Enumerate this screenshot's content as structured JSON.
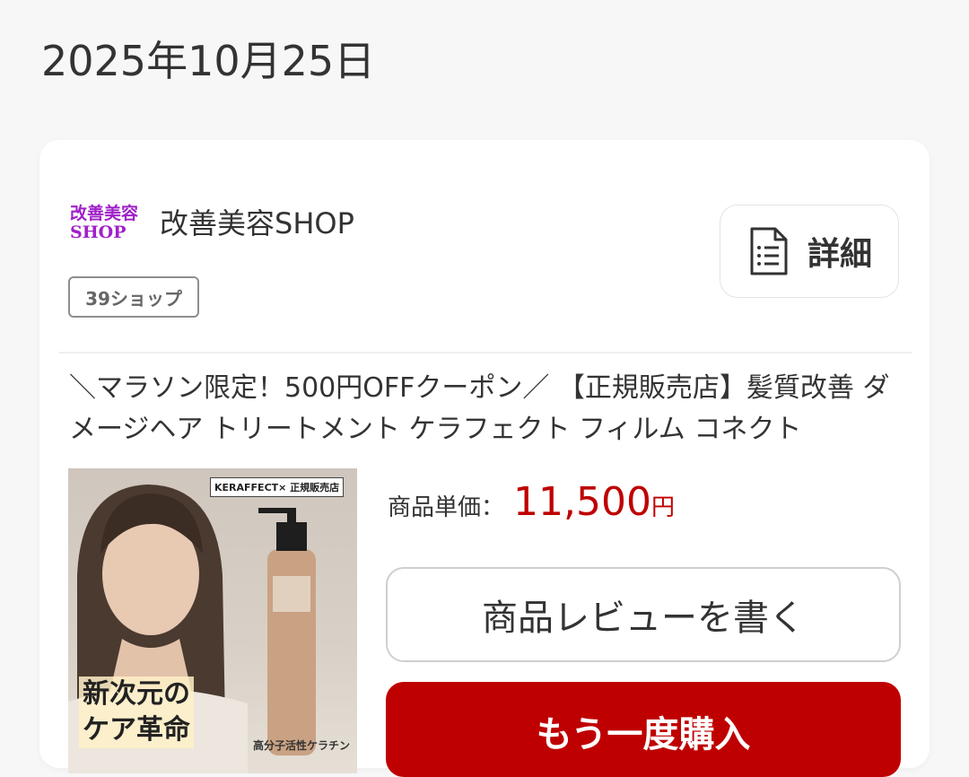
{
  "order": {
    "date": "2025年10月25日"
  },
  "shop": {
    "logo_line1": "改善美容",
    "logo_line2": "SHOP",
    "name": "改善美容SHOP",
    "badge": "39ショップ",
    "detail_label": "詳細"
  },
  "item": {
    "title": "＼マラソン限定！500円OFFクーポン／ 【正規販売店】髪質改善 ダメージヘア トリートメント ケラフェクト フィルム コネクト",
    "image": {
      "brand_tag": "KERAFFECT× 正規販売店",
      "catch_line1": "新次元の",
      "catch_line2": "ケア革命",
      "keratin_text": "高分子活性ケラチン"
    },
    "price_label": "商品単価：",
    "price_value": "11,500",
    "price_unit": "円",
    "review_button": "商品レビューを書く",
    "buy_again_button": "もう一度購入"
  },
  "colors": {
    "price": "#bf0000",
    "buy_button": "#bf0000",
    "logo": "#a020c8"
  },
  "icons": {
    "detail": "document-icon"
  }
}
